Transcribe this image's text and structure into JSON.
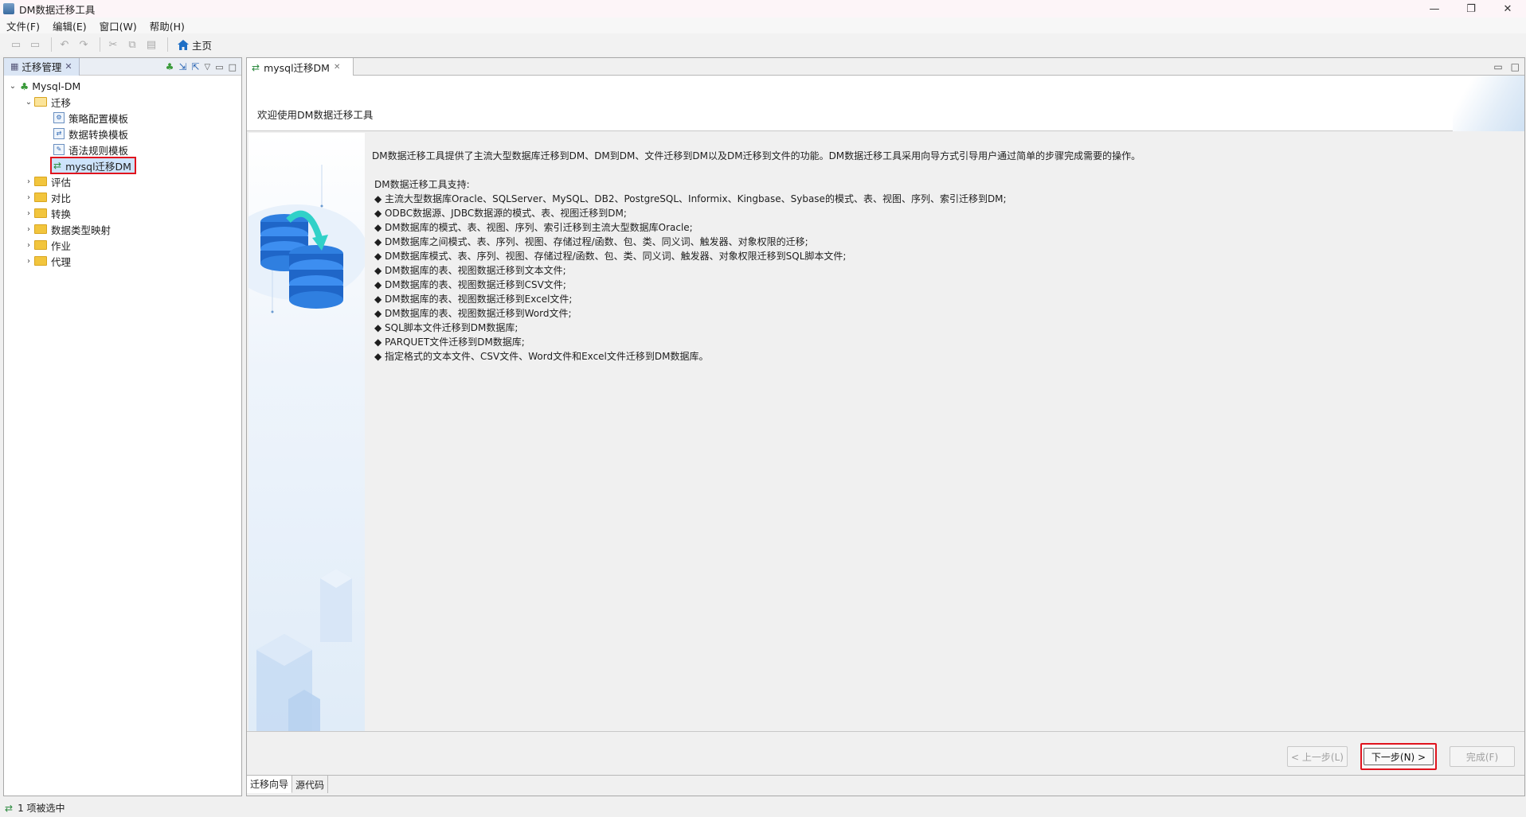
{
  "window": {
    "title": "DM数据迁移工具",
    "controls": [
      "—",
      "❐",
      "✕"
    ]
  },
  "menu": [
    "文件(F)",
    "编辑(E)",
    "窗口(W)",
    "帮助(H)"
  ],
  "toolbar": {
    "home_label": "主页"
  },
  "left_panel": {
    "tab_label": "迁移管理",
    "tree": {
      "root": "Mysql-DM",
      "migration_folder": "迁移",
      "migration_children": [
        "策略配置模板",
        "数据转换模板",
        "语法规则模板"
      ],
      "selected": "mysql迁移DM",
      "folders": [
        "评估",
        "对比",
        "转换",
        "数据类型映射",
        "作业",
        "代理"
      ]
    }
  },
  "editor": {
    "tab_label": "mysql迁移DM",
    "welcome_title": "欢迎使用DM数据迁移工具",
    "intro": "DM数据迁移工具提供了主流大型数据库迁移到DM、DM到DM、文件迁移到DM以及DM迁移到文件的功能。DM数据迁移工具采用向导方式引导用户通过简单的步骤完成需要的操作。",
    "support_title": "DM数据迁移工具支持:",
    "features": [
      "◆ 主流大型数据库Oracle、SQLServer、MySQL、DB2、PostgreSQL、Informix、Kingbase、Sybase的模式、表、视图、序列、索引迁移到DM;",
      "◆ ODBC数据源、JDBC数据源的模式、表、视图迁移到DM;",
      "◆ DM数据库的模式、表、视图、序列、索引迁移到主流大型数据库Oracle;",
      "◆ DM数据库之间模式、表、序列、视图、存储过程/函数、包、类、同义词、触发器、对象权限的迁移;",
      "◆ DM数据库模式、表、序列、视图、存储过程/函数、包、类、同义词、触发器、对象权限迁移到SQL脚本文件;",
      "◆ DM数据库的表、视图数据迁移到文本文件;",
      "◆ DM数据库的表、视图数据迁移到CSV文件;",
      "◆ DM数据库的表、视图数据迁移到Excel文件;",
      "◆ DM数据库的表、视图数据迁移到Word文件;",
      "◆ SQL脚本文件迁移到DM数据库;",
      "◆ PARQUET文件迁移到DM数据库;",
      "◆ 指定格式的文本文件、CSV文件、Word文件和Excel文件迁移到DM数据库。"
    ],
    "buttons": {
      "back": "< 上一步(L)",
      "next": "下一步(N) >",
      "finish": "完成(F)"
    },
    "bottom_tabs": [
      "迁移向导",
      "源代码"
    ]
  },
  "status": {
    "text": "1 项被选中"
  }
}
